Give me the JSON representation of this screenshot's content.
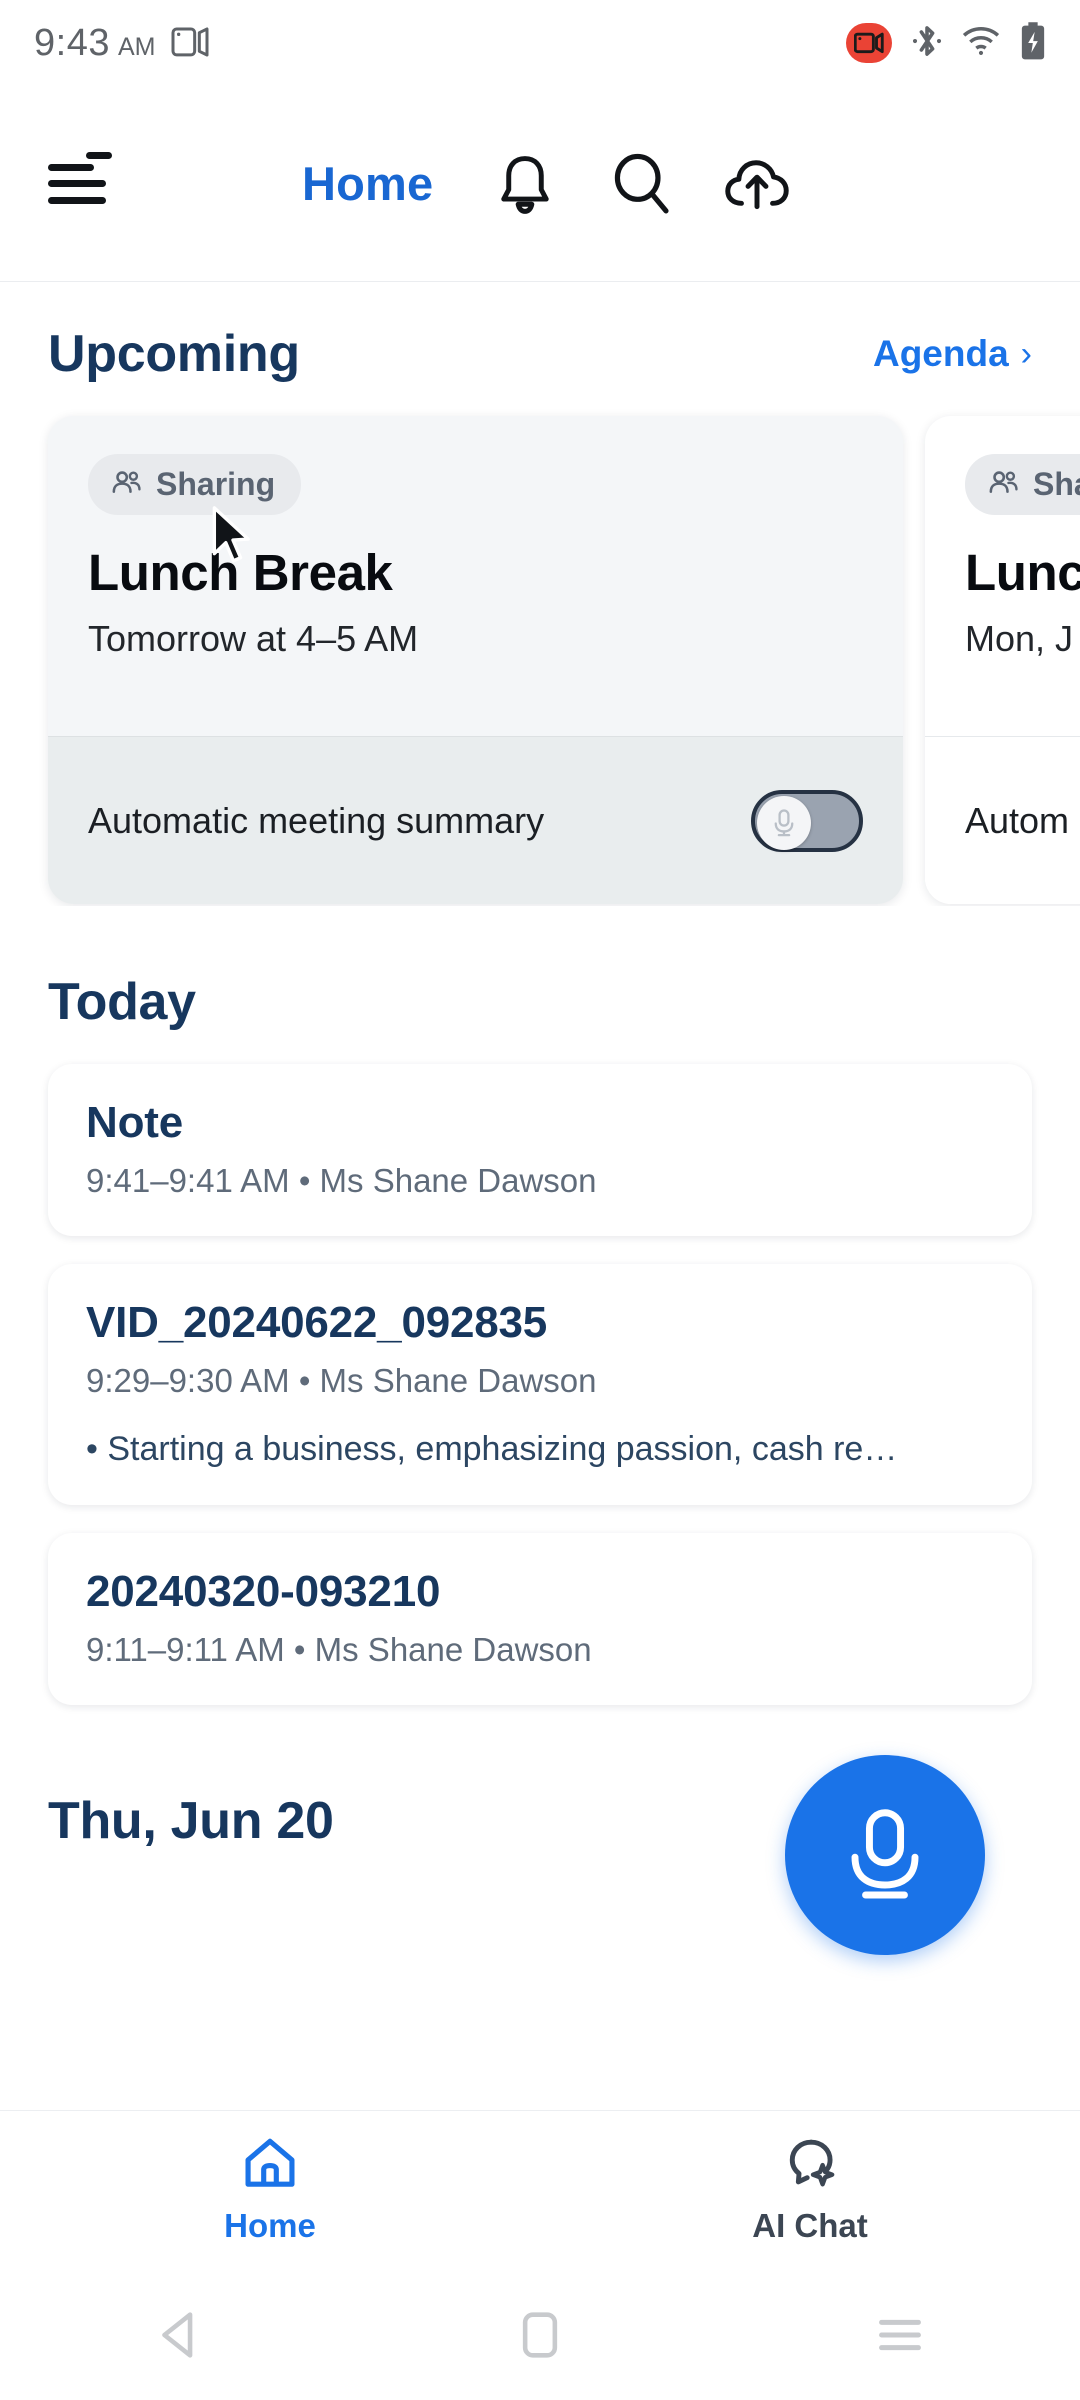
{
  "status_bar": {
    "time": "9:43",
    "ampm": "AM",
    "screencast_icon": "screen-record-icon",
    "recording_icon": "video-recording-icon",
    "bluetooth_icon": "bluetooth-icon",
    "wifi_icon": "wifi-icon",
    "battery_icon": "battery-charging-icon",
    "recording_badge_color": "#ea4335"
  },
  "app_bar": {
    "menu_icon": "hamburger-menu-icon",
    "menu_badge_color": "#d93025",
    "title": "Home",
    "title_color": "#1967d2",
    "notifications_icon": "bell-icon",
    "search_icon": "search-icon",
    "upload_icon": "cloud-upload-icon"
  },
  "upcoming": {
    "heading": "Upcoming",
    "link_label": "Agenda",
    "link_chevron": "›",
    "link_color": "#1a73e8",
    "cards": [
      {
        "badge": "Sharing",
        "badge_icon": "people-group-icon",
        "title": "Lunch Break",
        "subtitle": "Tomorrow at 4–5 AM",
        "toggle_label": "Automatic meeting summary",
        "toggle_state": "off",
        "toggle_icon": "microphone-icon"
      },
      {
        "badge": "Sha",
        "badge_icon": "people-group-icon",
        "title": "Lunc",
        "subtitle": "Mon, J",
        "toggle_label": "Autom",
        "toggle_state": "off",
        "toggle_icon": "microphone-icon"
      }
    ]
  },
  "today": {
    "heading": "Today",
    "items": [
      {
        "title": "Note",
        "meta": "9:41–9:41 AM  •  Ms Shane Dawson",
        "bullet": ""
      },
      {
        "title": "VID_20240622_092835",
        "meta": "9:29–9:30 AM  •  Ms Shane Dawson",
        "bullet": "•  Starting a business, emphasizing passion, cash re…"
      },
      {
        "title": "20240320-093210",
        "meta": "9:11–9:11 AM  •  Ms Shane Dawson",
        "bullet": ""
      }
    ]
  },
  "next_section": {
    "heading": "Thu, Jun 20"
  },
  "fab": {
    "icon": "microphone-icon",
    "color": "#1a73e8"
  },
  "bottom_nav": {
    "items": [
      {
        "label": "Home",
        "icon": "home-icon",
        "active": true
      },
      {
        "label": "AI Chat",
        "icon": "ai-chat-bubble-icon",
        "active": false
      }
    ],
    "active_color": "#1a73e8",
    "inactive_color": "#3c4653"
  },
  "system_nav": {
    "back_icon": "back-triangle-icon",
    "home_icon": "home-square-icon",
    "recents_icon": "recents-lines-icon"
  }
}
